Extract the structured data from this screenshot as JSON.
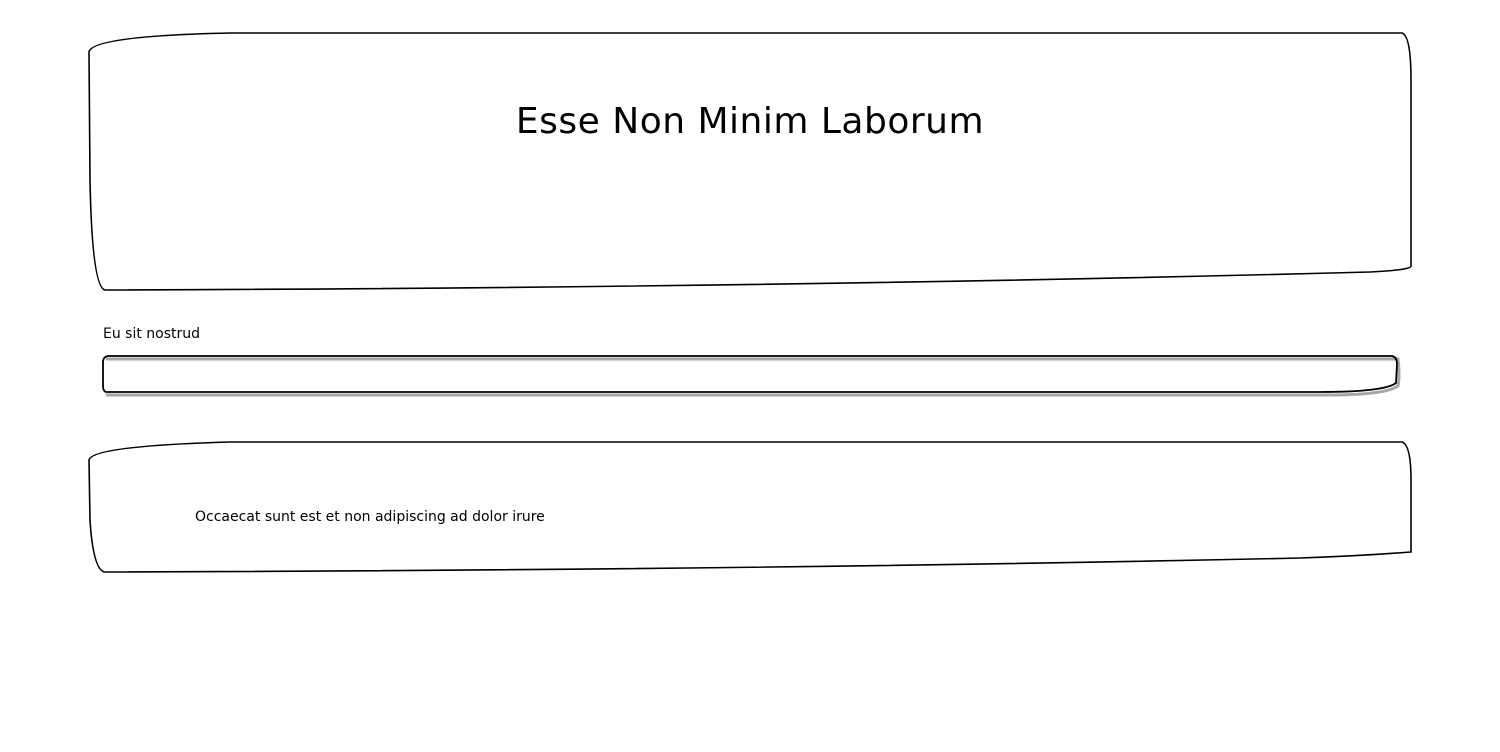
{
  "header": {
    "title": "Esse Non Minim Laborum"
  },
  "form": {
    "field_label": "Eu sit nostrud",
    "field_value": "",
    "field_placeholder": ""
  },
  "content": {
    "text": "Occaecat sunt est et non adipiscing ad dolor irure"
  }
}
